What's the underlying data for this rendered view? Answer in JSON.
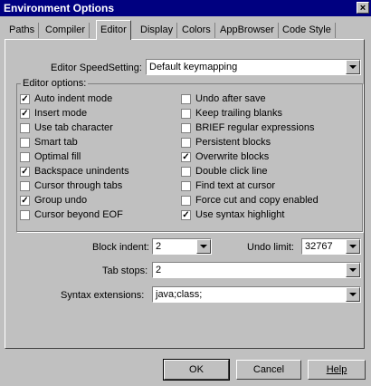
{
  "window": {
    "title": "Environment Options",
    "close_glyph": "×"
  },
  "tabs": [
    "Paths",
    "Compiler",
    "Editor",
    "Display",
    "Colors",
    "AppBrowser",
    "Code Style"
  ],
  "active_tab": "Editor",
  "speed_setting": {
    "label": "Editor SpeedSetting:",
    "value": "Default keymapping"
  },
  "editor_options": {
    "legend": "Editor options:",
    "left": [
      {
        "label": "Auto indent mode",
        "checked": true
      },
      {
        "label": "Insert mode",
        "checked": true
      },
      {
        "label": "Use tab character",
        "checked": false
      },
      {
        "label": "Smart tab",
        "checked": false
      },
      {
        "label": "Optimal fill",
        "checked": false
      },
      {
        "label": "Backspace unindents",
        "checked": true
      },
      {
        "label": "Cursor through tabs",
        "checked": false
      },
      {
        "label": "Group undo",
        "checked": true
      },
      {
        "label": "Cursor beyond EOF",
        "checked": false
      }
    ],
    "right": [
      {
        "label": "Undo after save",
        "checked": false
      },
      {
        "label": "Keep trailing blanks",
        "checked": false
      },
      {
        "label": "BRIEF regular expressions",
        "checked": false
      },
      {
        "label": "Persistent blocks",
        "checked": false
      },
      {
        "label": "Overwrite blocks",
        "checked": true
      },
      {
        "label": "Double click line",
        "checked": false
      },
      {
        "label": "Find text at cursor",
        "checked": false
      },
      {
        "label": "Force cut and copy enabled",
        "checked": false
      },
      {
        "label": "Use syntax highlight",
        "checked": true
      }
    ]
  },
  "block_indent": {
    "label": "Block indent:",
    "value": "2"
  },
  "undo_limit": {
    "label": "Undo limit:",
    "value": "32767"
  },
  "tab_stops": {
    "label": "Tab stops:",
    "value": "2"
  },
  "syntax_extensions": {
    "label": "Syntax extensions:",
    "value": "java;class;"
  },
  "buttons": {
    "ok": "OK",
    "cancel": "Cancel",
    "help": "Help"
  }
}
